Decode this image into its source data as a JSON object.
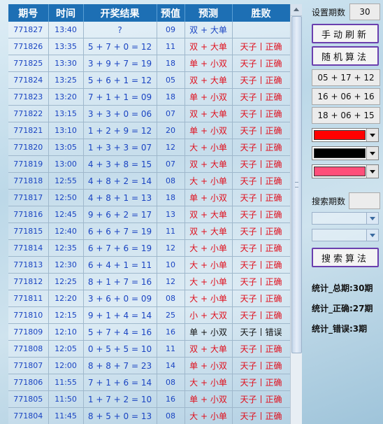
{
  "table": {
    "headers": [
      "期号",
      "时间",
      "开奖结果",
      "预值",
      "预测",
      "胜败"
    ],
    "rows": [
      {
        "id": "771827",
        "time": "13:40",
        "result": "?",
        "pre": "09",
        "pred": "双 + 大单",
        "pred_color": "blue",
        "outcome": ""
      },
      {
        "id": "771826",
        "time": "13:35",
        "result": "5 + 7 + 0 = 12",
        "pre": "11",
        "pred": "双 + 大单",
        "pred_color": "red",
        "outcome": "天子丨正确"
      },
      {
        "id": "771825",
        "time": "13:30",
        "result": "3 + 9 + 7 = 19",
        "pre": "18",
        "pred": "单 + 小双",
        "pred_color": "red",
        "outcome": "天子丨正确"
      },
      {
        "id": "771824",
        "time": "13:25",
        "result": "5 + 6 + 1 = 12",
        "pre": "05",
        "pred": "双 + 大单",
        "pred_color": "red",
        "outcome": "天子丨正确"
      },
      {
        "id": "771823",
        "time": "13:20",
        "result": "7 + 1 + 1 = 09",
        "pre": "18",
        "pred": "单 + 小双",
        "pred_color": "red",
        "outcome": "天子丨正确"
      },
      {
        "id": "771822",
        "time": "13:15",
        "result": "3 + 3 + 0 = 06",
        "pre": "07",
        "pred": "双 + 大单",
        "pred_color": "red",
        "outcome": "天子丨正确"
      },
      {
        "id": "771821",
        "time": "13:10",
        "result": "1 + 2 + 9 = 12",
        "pre": "20",
        "pred": "单 + 小双",
        "pred_color": "red",
        "outcome": "天子丨正确"
      },
      {
        "id": "771820",
        "time": "13:05",
        "result": "1 + 3 + 3 = 07",
        "pre": "12",
        "pred": "大 + 小单",
        "pred_color": "red",
        "outcome": "天子丨正确"
      },
      {
        "id": "771819",
        "time": "13:00",
        "result": "4 + 3 + 8 = 15",
        "pre": "07",
        "pred": "双 + 大单",
        "pred_color": "red",
        "outcome": "天子丨正确"
      },
      {
        "id": "771818",
        "time": "12:55",
        "result": "4 + 8 + 2 = 14",
        "pre": "08",
        "pred": "大 + 小单",
        "pred_color": "red",
        "outcome": "天子丨正确"
      },
      {
        "id": "771817",
        "time": "12:50",
        "result": "4 + 8 + 1 = 13",
        "pre": "18",
        "pred": "单 + 小双",
        "pred_color": "red",
        "outcome": "天子丨正确"
      },
      {
        "id": "771816",
        "time": "12:45",
        "result": "9 + 6 + 2 = 17",
        "pre": "13",
        "pred": "双 + 大单",
        "pred_color": "red",
        "outcome": "天子丨正确"
      },
      {
        "id": "771815",
        "time": "12:40",
        "result": "6 + 6 + 7 = 19",
        "pre": "11",
        "pred": "双 + 大单",
        "pred_color": "red",
        "outcome": "天子丨正确"
      },
      {
        "id": "771814",
        "time": "12:35",
        "result": "6 + 7 + 6 = 19",
        "pre": "12",
        "pred": "大 + 小单",
        "pred_color": "red",
        "outcome": "天子丨正确"
      },
      {
        "id": "771813",
        "time": "12:30",
        "result": "6 + 4 + 1 = 11",
        "pre": "10",
        "pred": "大 + 小单",
        "pred_color": "red",
        "outcome": "天子丨正确"
      },
      {
        "id": "771812",
        "time": "12:25",
        "result": "8 + 1 + 7 = 16",
        "pre": "12",
        "pred": "大 + 小单",
        "pred_color": "red",
        "outcome": "天子丨正确"
      },
      {
        "id": "771811",
        "time": "12:20",
        "result": "3 + 6 + 0 = 09",
        "pre": "08",
        "pred": "大 + 小单",
        "pred_color": "red",
        "outcome": "天子丨正确"
      },
      {
        "id": "771810",
        "time": "12:15",
        "result": "9 + 1 + 4 = 14",
        "pre": "25",
        "pred": "小 + 大双",
        "pred_color": "red",
        "outcome": "天子丨正确"
      },
      {
        "id": "771809",
        "time": "12:10",
        "result": "5 + 7 + 4 = 16",
        "pre": "16",
        "pred": "单 + 小双",
        "pred_color": "black",
        "outcome": "天子丨错误",
        "outcome_color": "black"
      },
      {
        "id": "771808",
        "time": "12:05",
        "result": "0 + 5 + 5 = 10",
        "pre": "11",
        "pred": "双 + 大单",
        "pred_color": "red",
        "outcome": "天子丨正确"
      },
      {
        "id": "771807",
        "time": "12:00",
        "result": "8 + 8 + 7 = 23",
        "pre": "14",
        "pred": "单 + 小双",
        "pred_color": "red",
        "outcome": "天子丨正确"
      },
      {
        "id": "771806",
        "time": "11:55",
        "result": "7 + 1 + 6 = 14",
        "pre": "08",
        "pred": "大 + 小单",
        "pred_color": "red",
        "outcome": "天子丨正确"
      },
      {
        "id": "771805",
        "time": "11:50",
        "result": "1 + 7 + 2 = 10",
        "pre": "16",
        "pred": "单 + 小双",
        "pred_color": "red",
        "outcome": "天子丨正确"
      },
      {
        "id": "771804",
        "time": "11:45",
        "result": "8 + 5 + 0 = 13",
        "pre": "08",
        "pred": "大 + 小单",
        "pred_color": "red",
        "outcome": "天子丨正确"
      }
    ]
  },
  "panel": {
    "period_label": "设置期数",
    "period_value": "30",
    "refresh_button": "手动刷新",
    "random_button": "随机算法",
    "formulas": [
      "05 + 17 + 12",
      "16 + 06 + 16",
      "18 + 06 + 15"
    ],
    "color_options": [
      "#ff0000",
      "#000000",
      "#ff4f7a"
    ],
    "search_label": "搜索期数",
    "search_value": "",
    "search_button": "搜索算法",
    "stats": {
      "total": "统计_总期:30期",
      "correct": "统计_正确:27期",
      "wrong": "统计_错误:3期"
    }
  },
  "colors": {
    "header_bg": "#1d6fb4",
    "red_text": "#e0101e",
    "blue_text": "#1a44c2",
    "button_border": "#6a3fae"
  }
}
